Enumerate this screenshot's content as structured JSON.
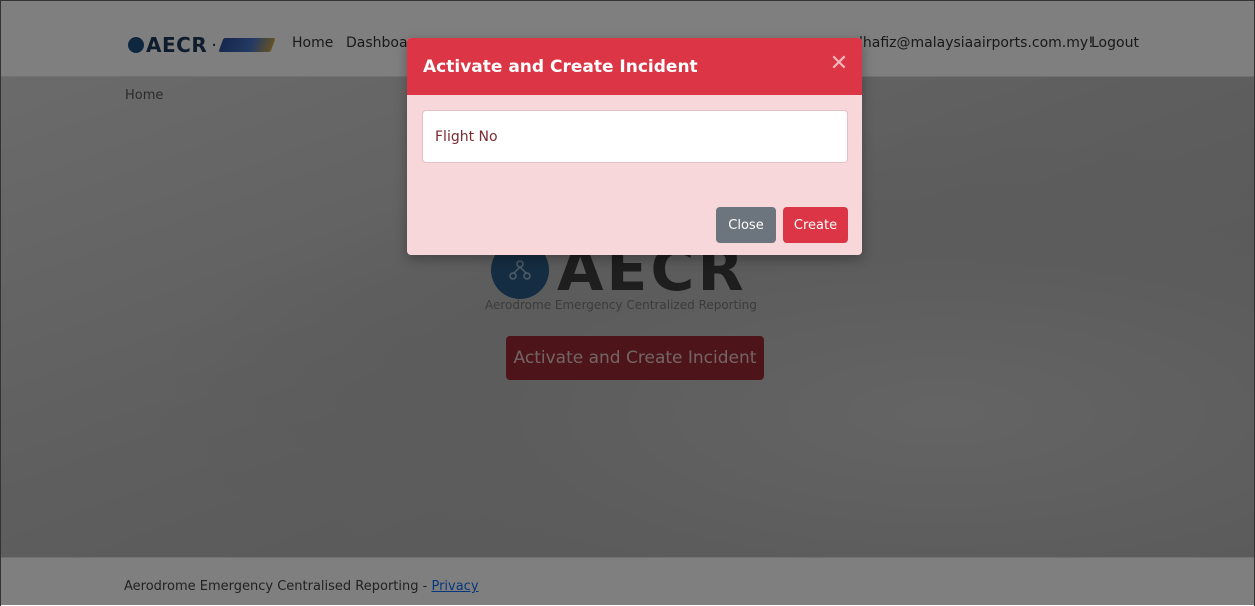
{
  "navbar": {
    "brand": "AECR",
    "brand_separator": "·",
    "home_label": "Home",
    "dashboard_label": "Dashboar",
    "user_email_label": "lhafiz@malaysiaairports.com.my!",
    "logout_label": "Logout"
  },
  "breadcrumb": "Home",
  "hero": {
    "logo_text": "AECR",
    "tagline": "Aerodrome Emergency Centralized Reporting",
    "activate_button": "Activate and Create Incident"
  },
  "footer": {
    "text": "Aerodrome Emergency Centralised Reporting - ",
    "privacy_link": "Privacy"
  },
  "modal": {
    "title": "Activate and Create Incident",
    "close_glyph": "✕",
    "flight_placeholder": "Flight No",
    "close_button": "Close",
    "create_button": "Create"
  },
  "colors": {
    "danger": "#dc3545",
    "modal_body": "#f8d7da",
    "secondary": "#6c757d",
    "hero_button": "#9b2a33"
  }
}
